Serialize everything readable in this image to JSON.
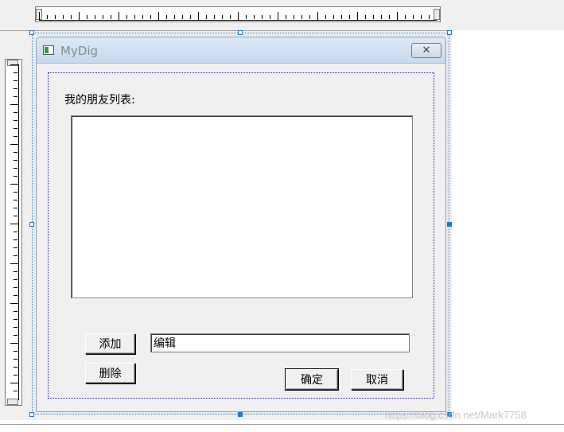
{
  "dialog": {
    "title": "MyDig",
    "close_symbol": "✕",
    "friends_label": "我的朋友列表:",
    "add_label": "添加",
    "delete_label": "删除",
    "edit_value": "编辑",
    "ok_label": "确定",
    "cancel_label": "取消"
  },
  "watermark": "https://blog.csdn.net/Mark7758",
  "icons": {
    "app": "dialog-app-icon",
    "close": "close-icon"
  }
}
